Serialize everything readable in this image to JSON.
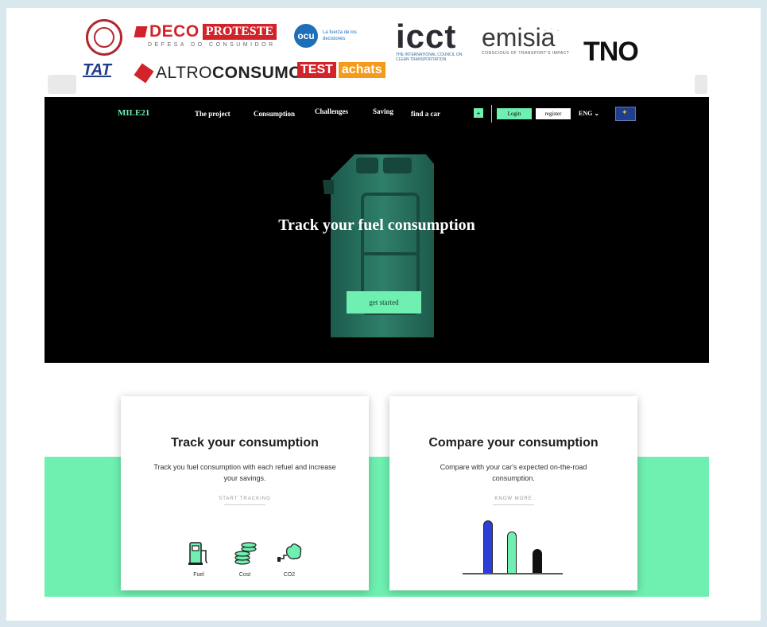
{
  "logos": {
    "deco_word": "DECO",
    "deco_pro_teste": "PROTESTE",
    "deco_sub": "DEFESA DO CONSUMIDOR",
    "ocu_word": "ocu",
    "ocu_tag": "La fuerza de los decisiones",
    "icct_word": "icct",
    "icct_sub": "THE INTERNATIONAL COUNCIL ON CLEAN TRANSPORTATION",
    "emisia_word": "emisia",
    "emisia_sub": "CONSCIOUS OF TRANSPORT'S IMPACT",
    "tno_word": "TNO",
    "tat_word": "TAT",
    "altro_light": "ALTRO",
    "altro_bold": "CONSUMO",
    "test_word": "TEST",
    "achats_word": "achats"
  },
  "nav": {
    "logo": "MILE21",
    "items": [
      "The project",
      "Consumption",
      "Challenges",
      "Saving",
      "find a car"
    ],
    "plus": "+",
    "login": "Login",
    "register": "register",
    "language": "ENG"
  },
  "hero": {
    "title": "Track your fuel consumption",
    "cta": "get started"
  },
  "cards": [
    {
      "title": "Track your consumption",
      "text": "Track you fuel consumption with each refuel and increase your savings.",
      "link": "START TRACKING",
      "icons": [
        {
          "icon": "fuel-pump-icon",
          "label": "Fuel"
        },
        {
          "icon": "coins-icon",
          "label": "Cost"
        },
        {
          "icon": "co2-cloud-icon",
          "label": "CO2"
        }
      ]
    },
    {
      "title": "Compare your consumption",
      "text": "Compare with your car's expected on-the-road consumption.",
      "link": "KNOW MORE",
      "bar_levels": [
        0.95,
        0.75,
        0.45
      ]
    }
  ],
  "colors": {
    "accent": "#6ff0b0",
    "hero_bg": "#000000",
    "bar_blue": "#2b3fd6",
    "bar_green": "#6ff0b0",
    "bar_black": "#111111"
  }
}
